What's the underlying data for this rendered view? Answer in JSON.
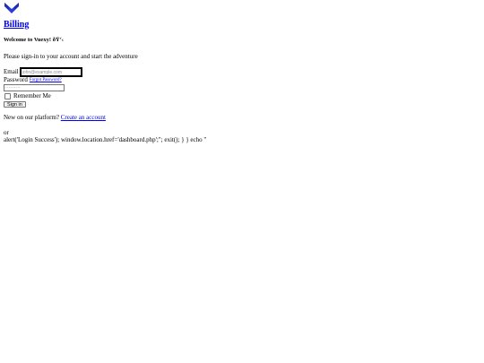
{
  "brand": {
    "logo_icon": "vuexy-logo-icon",
    "logo_color": "#2b3bd6",
    "name": "Billing"
  },
  "welcome": {
    "heading": "Welcome to Vuexy! ðŸ‘‹",
    "subtitle": "Please sign-in to your account and start the adventure"
  },
  "form": {
    "email_label": "Email",
    "email_placeholder": "john@example.com",
    "password_label": "Password",
    "forgot_label": "Forgot Password?",
    "password_placeholder": "··········",
    "remember_label": "Remember Me",
    "remember_checked": false,
    "signin_label": "Sign in"
  },
  "footer": {
    "new_text": "New on our platform?",
    "create_label": "Create an account",
    "or_text": "or",
    "script_text": "alert('Login Success'); window.location.href='dashboard.php';\"; exit(); } } echo \""
  }
}
